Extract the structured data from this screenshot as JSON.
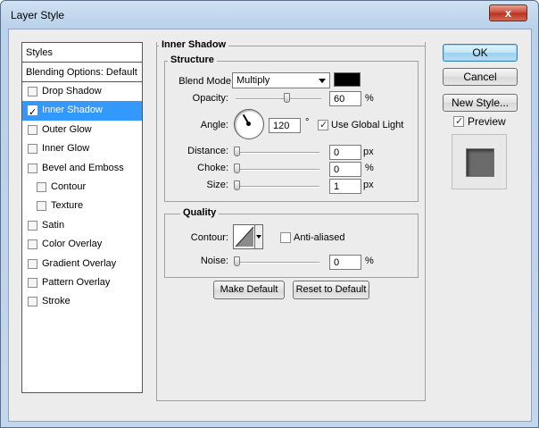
{
  "window": {
    "title": "Layer Style",
    "close_label": "x"
  },
  "styles_panel": {
    "header": "Styles",
    "blending": "Blending Options: Default",
    "items": [
      {
        "label": "Drop Shadow",
        "checked": false,
        "selected": false,
        "sub": false
      },
      {
        "label": "Inner Shadow",
        "checked": true,
        "selected": true,
        "sub": false
      },
      {
        "label": "Outer Glow",
        "checked": false,
        "selected": false,
        "sub": false
      },
      {
        "label": "Inner Glow",
        "checked": false,
        "selected": false,
        "sub": false
      },
      {
        "label": "Bevel and Emboss",
        "checked": false,
        "selected": false,
        "sub": false
      },
      {
        "label": "Contour",
        "checked": false,
        "selected": false,
        "sub": true
      },
      {
        "label": "Texture",
        "checked": false,
        "selected": false,
        "sub": true
      },
      {
        "label": "Satin",
        "checked": false,
        "selected": false,
        "sub": false
      },
      {
        "label": "Color Overlay",
        "checked": false,
        "selected": false,
        "sub": false
      },
      {
        "label": "Gradient Overlay",
        "checked": false,
        "selected": false,
        "sub": false
      },
      {
        "label": "Pattern Overlay",
        "checked": false,
        "selected": false,
        "sub": false
      },
      {
        "label": "Stroke",
        "checked": false,
        "selected": false,
        "sub": false
      }
    ]
  },
  "inner_shadow": {
    "title": "Inner Shadow",
    "structure": {
      "title": "Structure",
      "blend_mode_label": "Blend Mode:",
      "blend_mode_value": "Multiply",
      "shadow_color": "#000000",
      "opacity_label": "Opacity:",
      "opacity_value": "60",
      "opacity_unit": "%",
      "angle_label": "Angle:",
      "angle_value": "120",
      "angle_unit": "°",
      "use_global_light_label": "Use Global Light",
      "use_global_light": true,
      "distance_label": "Distance:",
      "distance_value": "0",
      "distance_unit": "px",
      "choke_label": "Choke:",
      "choke_value": "0",
      "choke_unit": "%",
      "size_label": "Size:",
      "size_value": "1",
      "size_unit": "px"
    },
    "quality": {
      "title": "Quality",
      "contour_label": "Contour:",
      "anti_aliased_label": "Anti-aliased",
      "anti_aliased": false,
      "noise_label": "Noise:",
      "noise_value": "0",
      "noise_unit": "%"
    },
    "make_default_label": "Make Default",
    "reset_default_label": "Reset to Default"
  },
  "buttons": {
    "ok": "OK",
    "cancel": "Cancel",
    "new_style": "New Style...",
    "preview_label": "Preview",
    "preview": true
  },
  "colors": {
    "selection": "#3399ff",
    "preview_swatch": "#6b6b6b"
  }
}
